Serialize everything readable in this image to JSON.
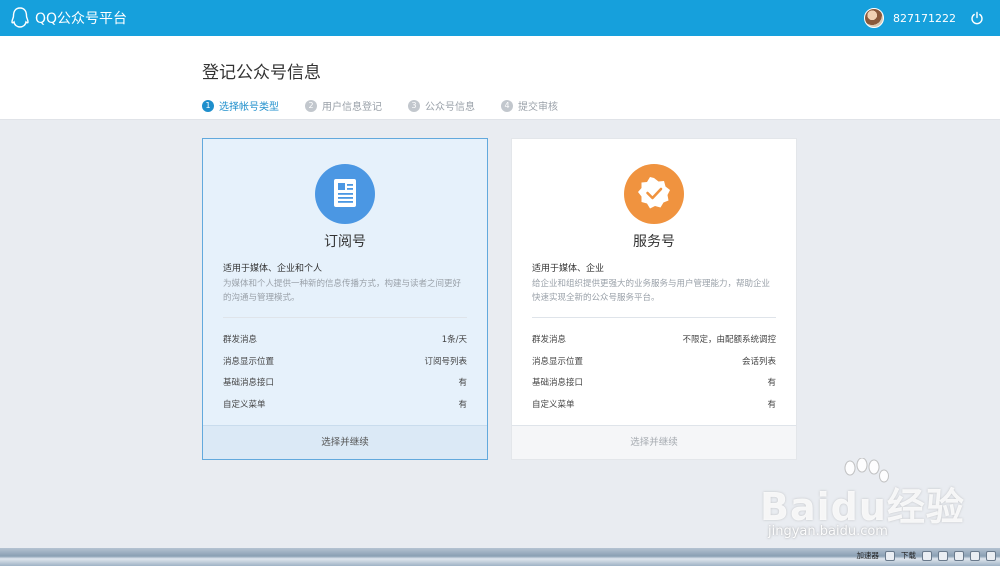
{
  "app": {
    "title": "QQ公众号平台",
    "user_id": "827171222"
  },
  "page": {
    "title": "登记公众号信息"
  },
  "steps": [
    {
      "num": "1",
      "label": "选择帐号类型",
      "active": true
    },
    {
      "num": "2",
      "label": "用户信息登记"
    },
    {
      "num": "3",
      "label": "公众号信息"
    },
    {
      "num": "4",
      "label": "提交审核"
    }
  ],
  "cards": [
    {
      "title": "订阅号",
      "audience": "适用于媒体、企业和个人",
      "description": "为媒体和个人提供一种新的信息传播方式，构建与读者之间更好的沟通与管理模式。",
      "features": [
        {
          "name": "群发消息",
          "value": "1条/天"
        },
        {
          "name": "消息显示位置",
          "value": "订阅号列表"
        },
        {
          "name": "基础消息接口",
          "value": "有"
        },
        {
          "name": "自定义菜单",
          "value": "有"
        }
      ],
      "action": "选择并继续",
      "icon": "document-icon",
      "color": "#4b97e3"
    },
    {
      "title": "服务号",
      "audience": "适用于媒体、企业",
      "description": "给企业和组织提供更强大的业务服务与用户管理能力，帮助企业快速实现全新的公众号服务平台。",
      "features": [
        {
          "name": "群发消息",
          "value": "不限定，由配额系统调控"
        },
        {
          "name": "消息显示位置",
          "value": "会话列表"
        },
        {
          "name": "基础消息接口",
          "value": "有"
        },
        {
          "name": "自定义菜单",
          "value": "有"
        }
      ],
      "action": "选择并继续",
      "icon": "verified-badge-icon",
      "color": "#f0933f"
    }
  ],
  "watermark": {
    "text": "Baidu经验",
    "url": "jingyan.baidu.com"
  },
  "taskbar": {
    "items": [
      "加速器",
      "下载"
    ]
  }
}
